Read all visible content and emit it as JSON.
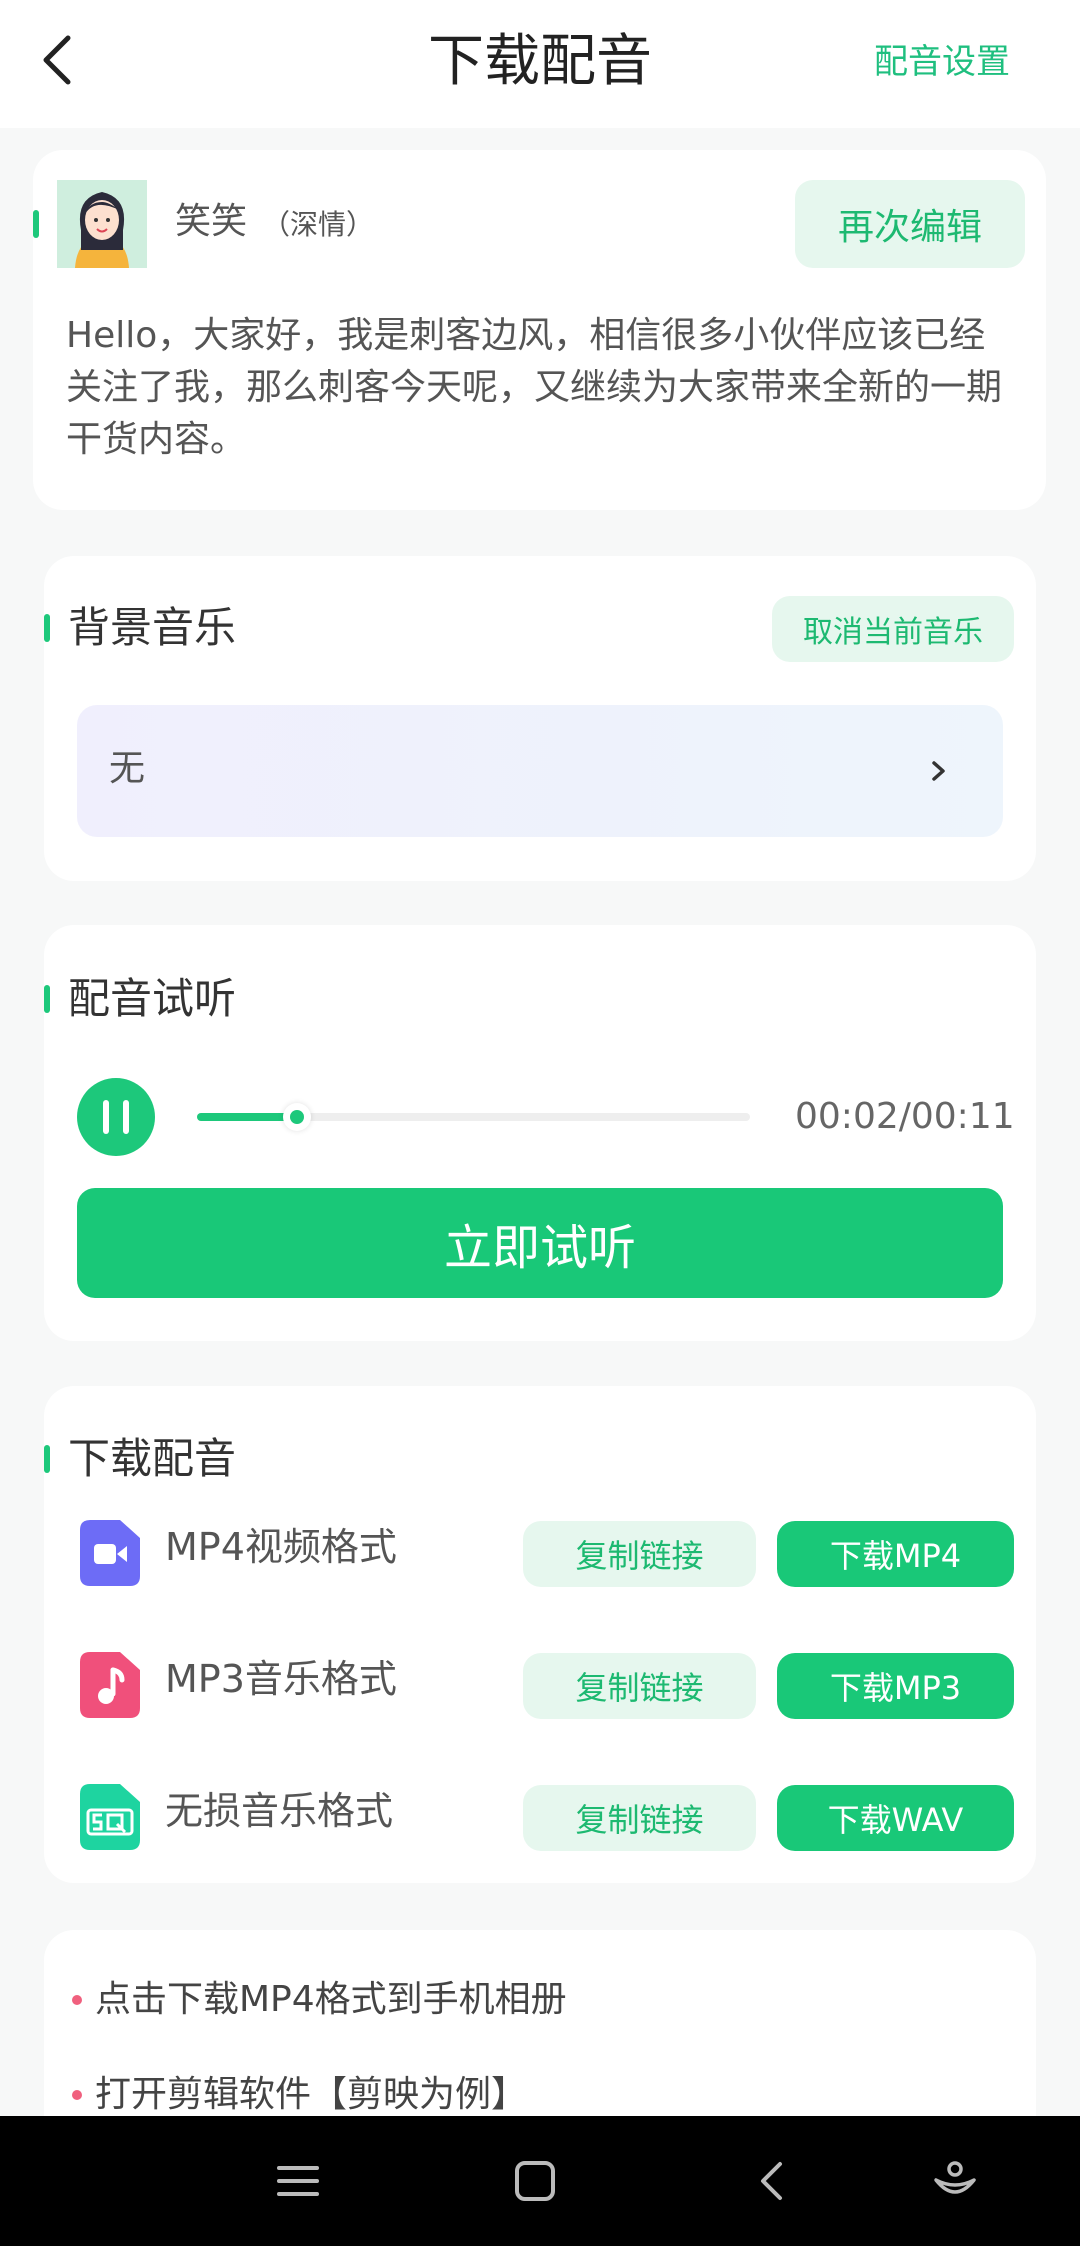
{
  "header": {
    "title": "下载配音",
    "settings_link": "配音设置"
  },
  "voice_card": {
    "name": "笑笑",
    "style": "（深情）",
    "edit_button": "再次编辑",
    "script": "Hello，大家好，我是刺客边风，相信很多小伙伴应该已经关注了我，那么刺客今天呢，又继续为大家带来全新的一期干货内容。"
  },
  "bg_music": {
    "title": "背景音乐",
    "cancel_button": "取消当前音乐",
    "selected": "无"
  },
  "preview": {
    "title": "配音试听",
    "time": "00:02/00:11",
    "progress": 0.18,
    "listen_button": "立即试听"
  },
  "download": {
    "title": "下载配音",
    "formats": [
      {
        "label": "MP4视频格式",
        "copy_button": "复制链接",
        "download_button": "下载MP4",
        "icon": "video-icon",
        "color": "#6d6cf6"
      },
      {
        "label": "MP3音乐格式",
        "copy_button": "复制链接",
        "download_button": "下载MP3",
        "icon": "music-file-icon",
        "color": "#f0507b"
      },
      {
        "label": "无损音乐格式",
        "copy_button": "复制链接",
        "download_button": "下载WAV",
        "icon": "sq-file-icon",
        "color": "#1ed4a0"
      }
    ]
  },
  "tips": [
    "点击下载MP4格式到手机相册",
    "打开剪辑软件【剪映为例】"
  ],
  "colors": {
    "accent": "#19c878",
    "accent_light": "#e6f7ee",
    "tip_dot": "#f0607e"
  }
}
